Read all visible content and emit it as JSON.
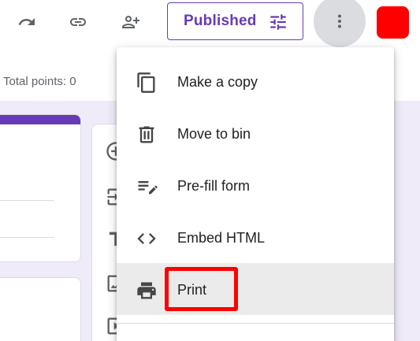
{
  "toolbar": {
    "redo_icon": "redo-icon",
    "link_icon": "link-icon",
    "add_collaborator_icon": "person-add-icon",
    "published_label": "Published",
    "publish_settings_icon": "tune-icon",
    "more_icon": "more-vert-icon",
    "avatar_color": "#ff0000"
  },
  "form": {
    "total_points": "Total points: 0",
    "accent_color": "#673ab7",
    "background_color": "#f0ebf8"
  },
  "menu": {
    "items": [
      {
        "label": "Make a copy",
        "icon": "copy-icon"
      },
      {
        "label": "Move to bin",
        "icon": "trash-icon"
      },
      {
        "label": "Pre-fill form",
        "icon": "prefill-icon"
      },
      {
        "label": "Embed HTML",
        "icon": "code-icon"
      },
      {
        "label": "Print",
        "icon": "print-icon",
        "hovered": true
      }
    ],
    "highlight_color": "#ff0000"
  }
}
